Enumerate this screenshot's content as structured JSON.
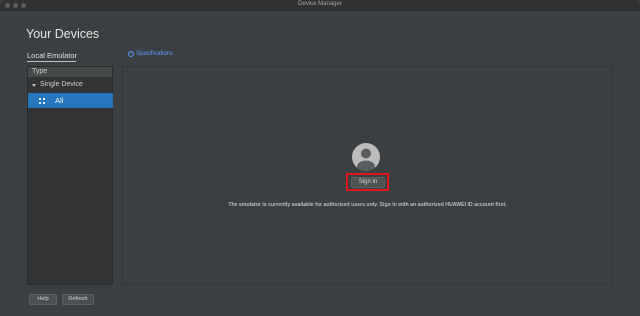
{
  "window": {
    "title": "Device Manager"
  },
  "header": {
    "title": "Your Devices"
  },
  "tabs": {
    "local_emulator": "Local Emulator"
  },
  "sidebar": {
    "header": "Type",
    "group": "Single Device",
    "items": [
      {
        "label": "All",
        "selected": true
      }
    ]
  },
  "main": {
    "specifications_link": "Specifications",
    "sign_in_label": "Sign in",
    "notice": "The emulator is currently available for authorized users only. Sign in with an authorized HUAWEI ID account first."
  },
  "footer": {
    "help_label": "Help",
    "refresh_label": "Refresh"
  },
  "icons": {
    "window_controls": [
      "close-icon",
      "minimize-icon",
      "zoom-icon"
    ],
    "specifications": "help-circle-icon",
    "group_toggle": "triangle-down-icon",
    "all_item": "grid-icon",
    "avatar": "user-avatar-icon"
  },
  "colors": {
    "selection": "#2675bf",
    "link": "#589df6",
    "highlight": "#e01818"
  }
}
